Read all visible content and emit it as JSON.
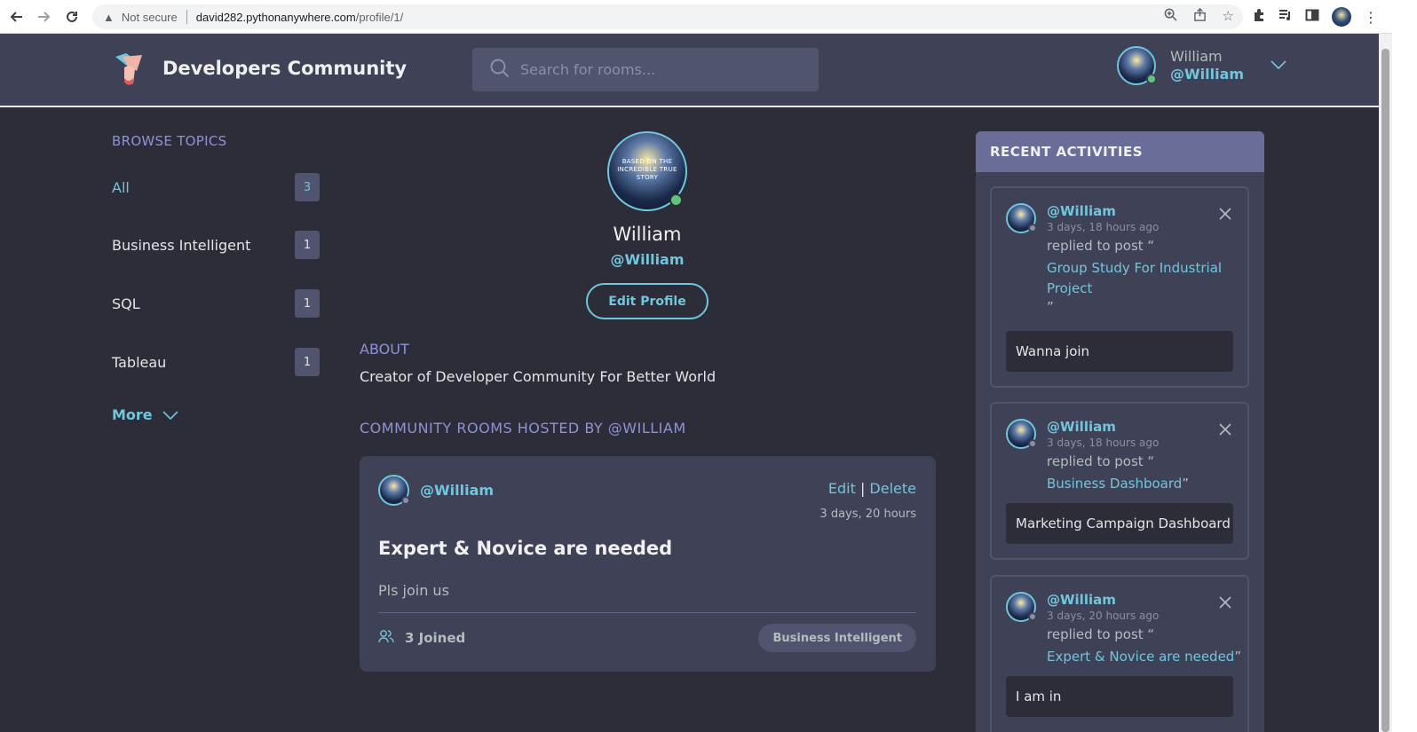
{
  "browser": {
    "not_secure": "Not secure",
    "url_host": "david282.pythonanywhere.com",
    "url_path": "/profile/1/"
  },
  "header": {
    "brand": "Developers Community",
    "search_placeholder": "Search for rooms...",
    "user_name": "William",
    "user_handle": "@William"
  },
  "sidebar": {
    "title": "BROWSE TOPICS",
    "topics": [
      {
        "label": "All",
        "count": "3"
      },
      {
        "label": "Business Intelligent",
        "count": "1"
      },
      {
        "label": "SQL",
        "count": "1"
      },
      {
        "label": "Tableau",
        "count": "1"
      }
    ],
    "more": "More"
  },
  "profile": {
    "avatar_text": "BASED ON THE INCREDIBLE TRUE STORY",
    "name": "William",
    "handle": "@William",
    "edit_button": "Edit Profile",
    "about_label": "ABOUT",
    "about_text": "Creator of Developer Community For Better World",
    "rooms_label": "COMMUNITY ROOMS HOSTED BY @WILLIAM"
  },
  "room": {
    "host": "@William",
    "edit": "Edit",
    "separator": "|",
    "delete": "Delete",
    "time": "3 days, 20 hours",
    "title": "Expert & Novice are needed",
    "description": "Pls join us",
    "joined": "3 Joined",
    "topic": "Business Intelligent"
  },
  "activities": {
    "title": "RECENT ACTIVITIES",
    "items": [
      {
        "handle": "@William",
        "time": "3 days, 18 hours ago",
        "action": "replied to post “",
        "post": "Group Study For Industrial Project",
        "close_quote": "”",
        "message": "Wanna join"
      },
      {
        "handle": "@William",
        "time": "3 days, 18 hours ago",
        "action": "replied to post “",
        "post": "Business Dashboard",
        "close_quote": "”",
        "message": "Marketing Campaign Dashboard"
      },
      {
        "handle": "@William",
        "time": "3 days, 20 hours ago",
        "action": "replied to post “",
        "post": "Expert & Novice are needed",
        "close_quote": "”",
        "message": "I am in"
      }
    ]
  },
  "colors": {
    "accent": "#71c6dd",
    "background": "#2d2d39",
    "panel": "#3f4156",
    "heading": "#8f93d5",
    "online": "#5dc67a"
  },
  "icons": [
    "back-icon",
    "forward-icon",
    "reload-icon",
    "warning-icon",
    "zoom-icon",
    "share-icon",
    "star-icon",
    "extensions-icon",
    "media-icon",
    "sidepanel-icon",
    "menu-icon",
    "search-icon",
    "chevron-down-icon",
    "users-icon",
    "close-icon"
  ]
}
